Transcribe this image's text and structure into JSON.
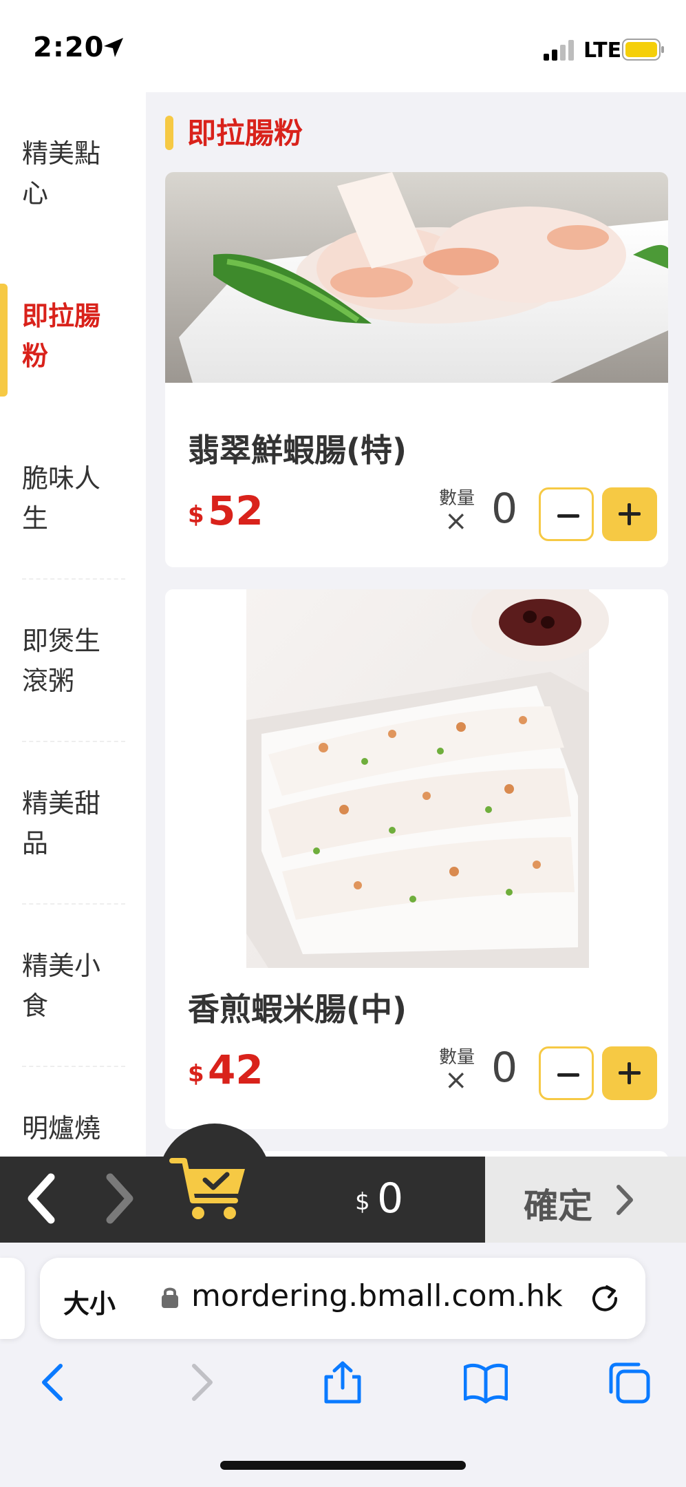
{
  "status_bar": {
    "time": "2:20",
    "network": "LTE"
  },
  "sidebar": {
    "items": [
      {
        "label": "精美點心",
        "active": false
      },
      {
        "label": "即拉腸粉",
        "active": true
      },
      {
        "label": "脆味人生",
        "active": false
      },
      {
        "label": "即煲生滾粥",
        "active": false
      },
      {
        "label": "精美甜品",
        "active": false
      },
      {
        "label": "精美小食",
        "active": false
      },
      {
        "label": "明爐燒",
        "active": false
      }
    ]
  },
  "section": {
    "title": "即拉腸粉"
  },
  "products": [
    {
      "name": "翡翠鮮蝦腸(特)",
      "currency": "$",
      "price": "52",
      "qty_label": "數量",
      "qty_x": "×",
      "quantity": "0"
    },
    {
      "name": "香煎蝦米腸(中)",
      "currency": "$",
      "price": "42",
      "qty_label": "數量",
      "qty_x": "×",
      "quantity": "0"
    }
  ],
  "cart": {
    "currency": "$",
    "total": "0",
    "confirm_label": "確定"
  },
  "browser": {
    "text_size_label": "大小",
    "url": "mordering.bmall.com.hk"
  },
  "colors": {
    "accent_yellow": "#f6c944",
    "accent_red": "#d9221b",
    "cart_bar": "#2f2f2f",
    "content_bg": "#f2f2f6",
    "ios_blue": "#0a7aff"
  }
}
